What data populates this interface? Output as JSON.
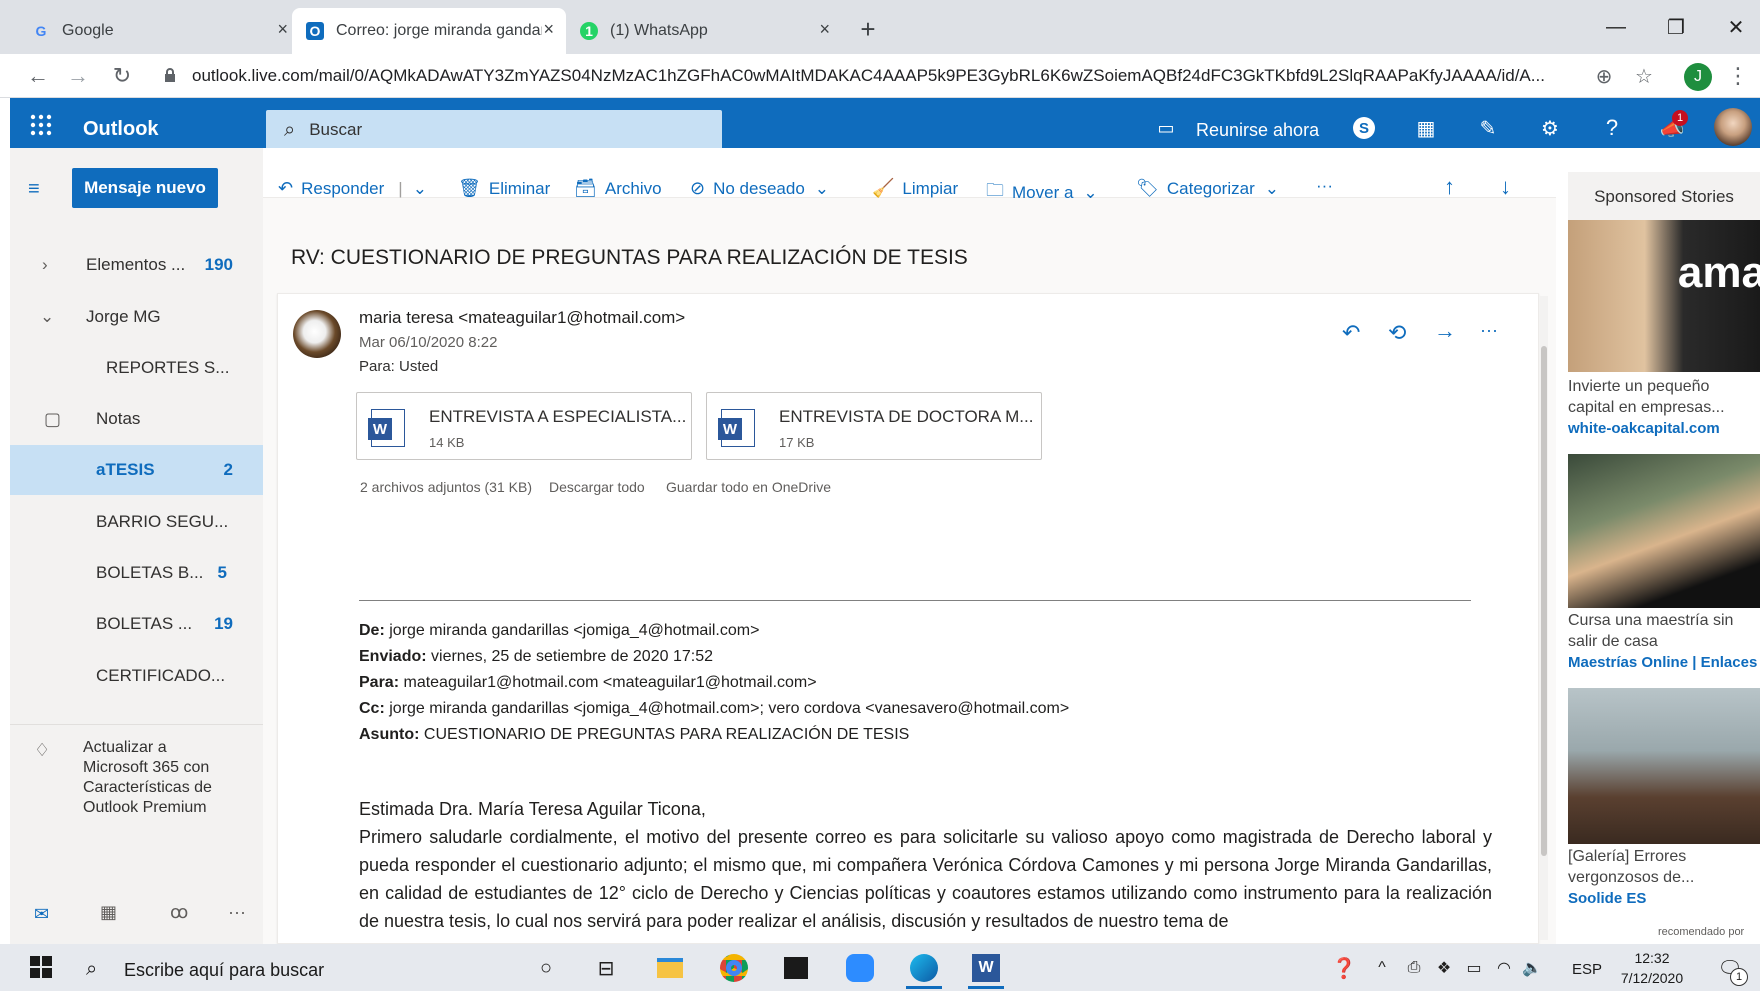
{
  "browser": {
    "tabs": [
      {
        "label": "Google",
        "icon": "google-icon",
        "icon_char": "G"
      },
      {
        "label": "Correo: jorge miranda gandarilla",
        "icon": "outlook-icon",
        "icon_char": "O"
      },
      {
        "label": "(1) WhatsApp",
        "icon": "whatsapp-icon",
        "icon_char": "1"
      }
    ],
    "close_glyph": "×",
    "new_tab": "+",
    "url": "outlook.live.com/mail/0/AQMkADAwATY3ZmYAZS04NzMzAC1hZGFhAC0wMAItMDAKAC4AAAP5k9PE3GybRL6K6wZSoiemAQBf24dFC3GkTKbfd9L2SlqRAAPaKfyJAAAA/id/A...",
    "profile_initial": "J",
    "window": {
      "minimize": "—",
      "restore": "❐",
      "close": "✕"
    }
  },
  "outlook": {
    "app_name": "Outlook",
    "search_placeholder": "Buscar",
    "meet_now": "Reunirse ahora",
    "notification_count": "1",
    "new_message": "Mensaje nuevo"
  },
  "nav": {
    "folders": [
      {
        "label": "Elementos ...",
        "count": "190",
        "caret": "›"
      },
      {
        "label": "Jorge MG",
        "count": "",
        "caret": "⌄"
      },
      {
        "label": "REPORTES S...",
        "count": "",
        "caret": ""
      },
      {
        "label": "Notas",
        "count": "",
        "caret": ""
      },
      {
        "label": "aTESIS",
        "count": "2",
        "caret": ""
      },
      {
        "label": "BARRIO SEGU...",
        "count": "",
        "caret": ""
      },
      {
        "label": "BOLETAS B...",
        "count": "5",
        "caret": ""
      },
      {
        "label": "BOLETAS ...",
        "count": "19",
        "caret": ""
      },
      {
        "label": "CERTIFICADO...",
        "count": "",
        "caret": ""
      }
    ],
    "upgrade_text": "Actualizar a Microsoft 365 con Características de Outlook Premium",
    "more": "···"
  },
  "toolbar": {
    "reply": "Responder",
    "delete": "Eliminar",
    "archive": "Archivo",
    "junk": "No deseado",
    "sweep": "Limpiar",
    "move": "Mover a",
    "categorize": "Categorizar",
    "more": "···"
  },
  "message": {
    "subject": "RV: CUESTIONARIO DE PREGUNTAS PARA REALIZACIÓN DE TESIS",
    "from": "maria teresa <mateaguilar1@hotmail.com>",
    "date": "Mar 06/10/2020 8:22",
    "to": "Para:  Usted",
    "attachments": [
      {
        "name": "ENTREVISTA A ESPECIALISTA...",
        "size": "14 KB"
      },
      {
        "name": "ENTREVISTA DE DOCTORA M...",
        "size": "17 KB"
      }
    ],
    "attach_summary": "2 archivos adjuntos (31 KB)",
    "download_all": "Descargar todo",
    "save_onedrive": "Guardar todo en OneDrive",
    "fwd": {
      "from_label": "De:",
      "from": "jorge miranda gandarillas <jomiga_4@hotmail.com>",
      "sent_label": "Enviado:",
      "sent": "viernes, 25 de setiembre de 2020 17:52",
      "to_label": "Para:",
      "to": "mateaguilar1@hotmail.com <mateaguilar1@hotmail.com>",
      "cc_label": "Cc:",
      "cc": "jorge miranda gandarillas <jomiga_4@hotmail.com>; vero cordova <vanesavero@hotmail.com>",
      "subj_label": "Asunto:",
      "subj": "CUESTIONARIO DE PREGUNTAS PARA REALIZACIÓN DE TESIS"
    },
    "greeting": "Estimada Dra. María Teresa Aguilar Ticona,",
    "body": "Primero saludarle cordialmente, el motivo del presente correo es para solicitarle su valioso apoyo como magistrada de Derecho laboral y pueda responder el cuestionario adjunto; el mismo que, mi compañera Verónica Córdova Camones y mi persona Jorge Miranda Gandarillas, en calidad de estudiantes de 12° ciclo de Derecho y Ciencias políticas y coautores estamos utilizando como instrumento para la realización de nuestra tesis, lo cual nos servirá para poder realizar el análisis, discusión y resultados de nuestro tema de"
  },
  "ads": {
    "header": "Sponsored Stories",
    "items": [
      {
        "title": "Invierte un pequeño capital en empresas...",
        "source": "white-oakcapital.com"
      },
      {
        "title": "Cursa una maestría sin salir de casa",
        "source": "Maestrías Online | Enlaces ..."
      },
      {
        "title": "[Galería] Errores vergonzosos de...",
        "source": "Soolide ES"
      }
    ],
    "footer": "recomendado por",
    "brand_text": "ama"
  },
  "taskbar": {
    "search_placeholder": "Escribe aquí para buscar",
    "lang": "ESP",
    "time": "12:32",
    "date": "7/12/2020",
    "notif_count": "1"
  },
  "colors": {
    "outlook_blue": "#0f6cbd",
    "selected_folder": "#c7e0f4"
  }
}
